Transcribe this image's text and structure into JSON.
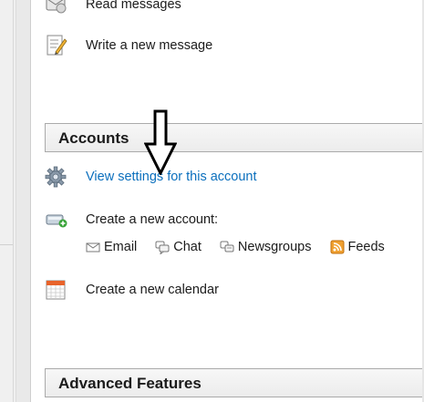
{
  "items": {
    "read": "Read messages",
    "write": "Write a new message"
  },
  "accounts": {
    "title": "Accounts",
    "view_settings": "View settings for this account",
    "create_account": "Create a new account:",
    "types": [
      "Email",
      "Chat",
      "Newsgroups",
      "Feeds"
    ],
    "create_calendar": "Create a new calendar"
  },
  "advanced": {
    "title": "Advanced Features"
  },
  "colors": {
    "link": "#0b6fbd",
    "feeds_orange": "#f0a030"
  }
}
